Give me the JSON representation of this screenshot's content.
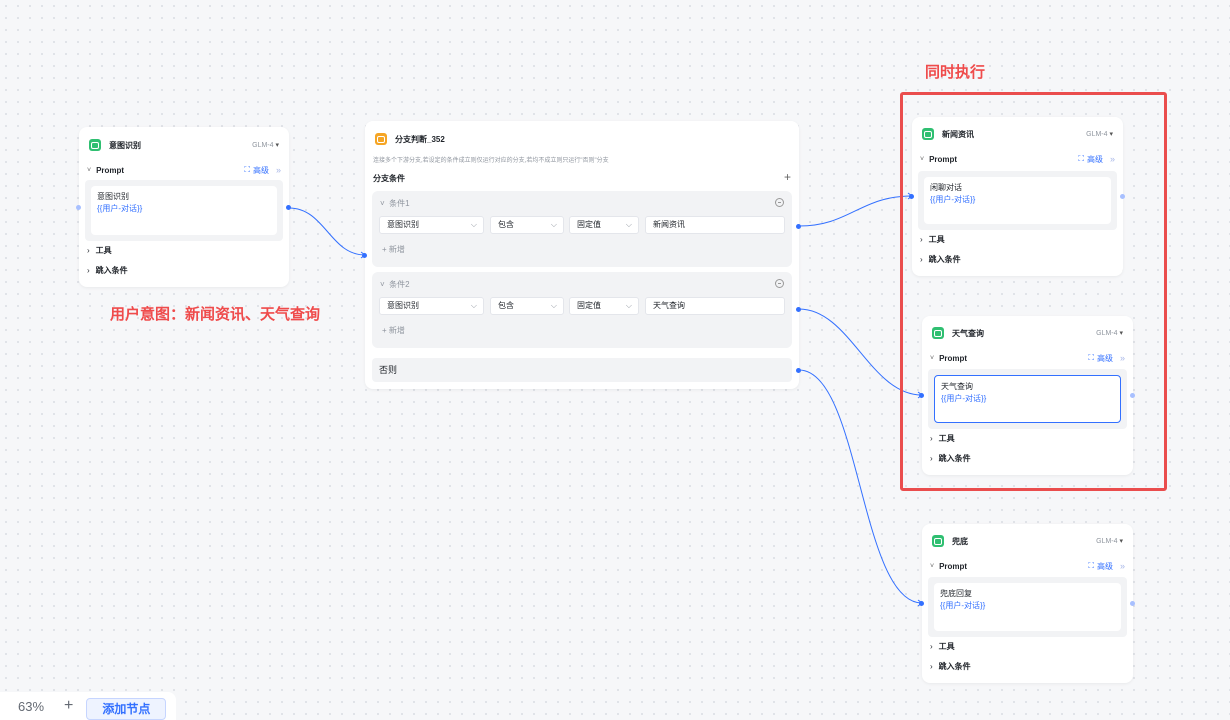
{
  "canvas": {
    "zoom_label": "63%",
    "zoom_in_symbol": "+",
    "add_node_label": "添加节点"
  },
  "annotations": {
    "user_intent": "用户意图：新闻资讯、天气查询",
    "parallel": "同时执行"
  },
  "nodes": {
    "intent": {
      "title": "意图识别",
      "model": "GLM-4",
      "prompt_label": "Prompt",
      "advanced_label": "高级",
      "prompt_text": "意图识别",
      "prompt_var": "{{用户-对话}}",
      "tools_label": "工具",
      "jump_label": "跳入条件"
    },
    "branch": {
      "title": "分支判断_352",
      "description": "连接多个下游分支,若设定的条件成立则仅运行对应的分支,若均不成立则只运行\"否则\"分支",
      "conditions_label": "分支条件",
      "add_symbol": "+",
      "conditions": [
        {
          "title": "条件1",
          "variable": "意图识别",
          "operator": "包含",
          "value_type": "固定值",
          "value": "新闻资讯",
          "add_label": "+ 新增"
        },
        {
          "title": "条件2",
          "variable": "意图识别",
          "operator": "包含",
          "value_type": "固定值",
          "value": "天气查询",
          "add_label": "+ 新增"
        }
      ],
      "else_label": "否则"
    },
    "news": {
      "title": "新闻资讯",
      "model": "GLM-4",
      "prompt_label": "Prompt",
      "advanced_label": "高级",
      "prompt_text": "闲聊对话",
      "prompt_var": "{{用户-对话}}",
      "tools_label": "工具",
      "jump_label": "跳入条件"
    },
    "weather": {
      "title": "天气查询",
      "model": "GLM-4",
      "prompt_label": "Prompt",
      "advanced_label": "高级",
      "prompt_text": "天气查询",
      "prompt_var": "{{用户-对话}}",
      "tools_label": "工具",
      "jump_label": "跳入条件"
    },
    "fallback": {
      "title": "兜底",
      "model": "GLM-4",
      "prompt_label": "Prompt",
      "advanced_label": "高级",
      "prompt_text": "兜底回复",
      "prompt_var": "{{用户-对话}}",
      "tools_label": "工具",
      "jump_label": "跳入条件"
    }
  },
  "colors": {
    "accent": "#3370ff",
    "llm_icon": "#2fbf71",
    "branch_icon": "#f5a524",
    "annotation_red": "#ea4d4d"
  }
}
